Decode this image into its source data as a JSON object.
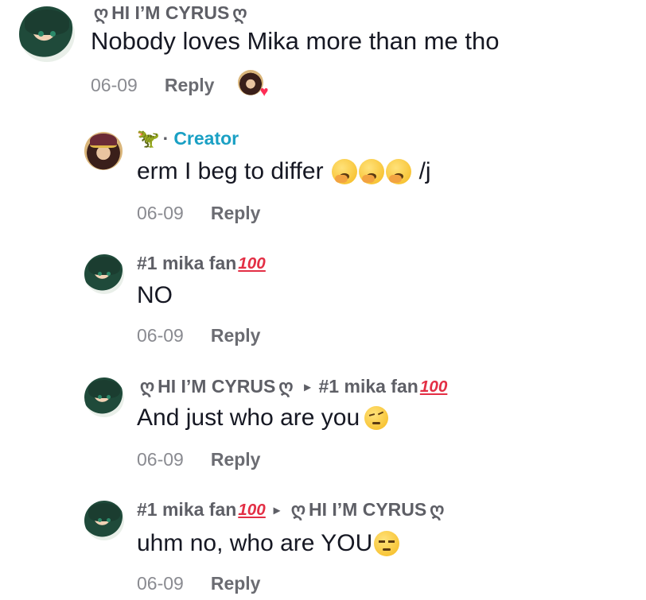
{
  "comments": [
    {
      "username": "HI I’M CYRUS",
      "swirl": "ღ",
      "text": "Nobody loves Mika more than me tho",
      "date": "06-09",
      "reply": "Reply"
    },
    {
      "creator_label": "Creator",
      "separator": "·",
      "text": "erm I beg to differ",
      "text_suffix": "/j",
      "date": "06-09",
      "reply": "Reply"
    },
    {
      "username": "#1 mika fan",
      "hundred": "100",
      "text": "NO",
      "date": "06-09",
      "reply": "Reply"
    },
    {
      "username": "HI I’M CYRUS",
      "swirl": "ღ",
      "reply_to": "#1 mika fan",
      "hundred": "100",
      "text": "And just who are you",
      "date": "06-09",
      "reply": "Reply"
    },
    {
      "username": "#1 mika fan",
      "hundred": "100",
      "reply_to": "HI I’M CYRUS",
      "swirl": "ღ",
      "text": "uhm no, who are YOU",
      "date": "06-09",
      "reply": "Reply"
    }
  ],
  "icons": {
    "arrow": "▸",
    "heart": "♥",
    "dino": "🦖"
  },
  "colors": {
    "creator": "#1aa0c4",
    "heart": "#fe2c55",
    "hundred": "#e32f45"
  }
}
